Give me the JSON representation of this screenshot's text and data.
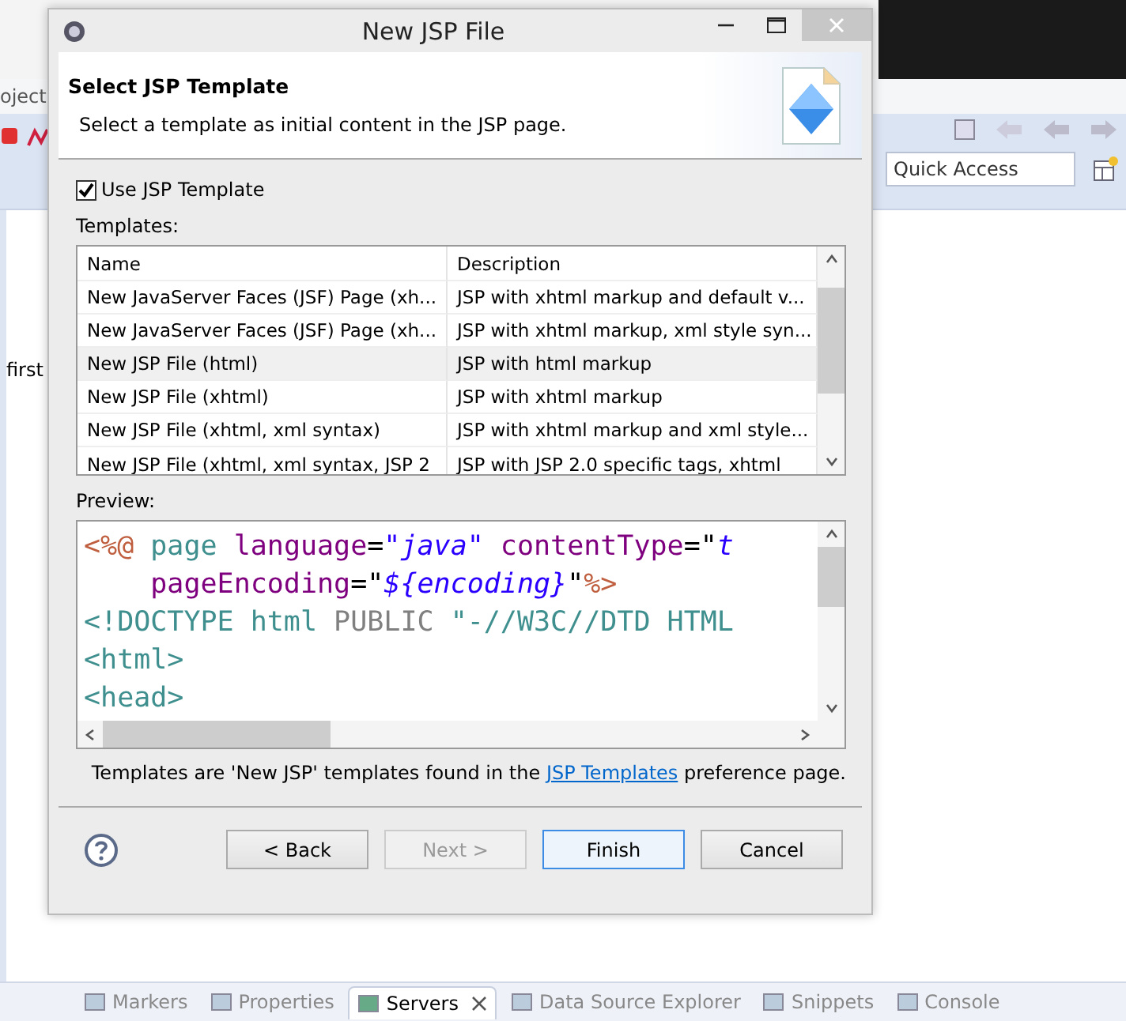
{
  "ide": {
    "menu_fragment": "oject",
    "editor_fragment": "first",
    "quick_access": {
      "placeholder": "Quick Access"
    },
    "views": [
      {
        "label": "Markers",
        "selected": false,
        "closable": false
      },
      {
        "label": "Properties",
        "selected": false,
        "closable": false
      },
      {
        "label": "Servers",
        "selected": true,
        "closable": true
      },
      {
        "label": "Data Source Explorer",
        "selected": false,
        "closable": false
      },
      {
        "label": "Snippets",
        "selected": false,
        "closable": false
      },
      {
        "label": "Console",
        "selected": false,
        "closable": false
      }
    ]
  },
  "dialog": {
    "title": "New JSP File",
    "banner": {
      "title": "Select JSP Template",
      "message": "Select a template as initial content in the JSP page."
    },
    "use_template": {
      "label": "Use JSP Template",
      "checked": true
    },
    "templates_label": "Templates:",
    "table": {
      "columns": [
        "Name",
        "Description"
      ],
      "rows": [
        {
          "name": "New JavaServer Faces (JSF) Page (xh...",
          "description": "JSP with xhtml markup and default v...",
          "selected": false
        },
        {
          "name": "New JavaServer Faces (JSF) Page (xh...",
          "description": "JSP with xhtml markup, xml style syn...",
          "selected": false
        },
        {
          "name": "New JSP File (html)",
          "description": "JSP with html markup",
          "selected": true
        },
        {
          "name": "New JSP File (xhtml)",
          "description": "JSP with xhtml markup",
          "selected": false
        },
        {
          "name": "New JSP File (xhtml, xml syntax)",
          "description": "JSP with xhtml markup and xml style...",
          "selected": false
        },
        {
          "name": "New JSP File (xhtml, xml syntax, JSP 2",
          "description": "JSP with JSP 2.0 specific tags, xhtml",
          "selected": false
        }
      ]
    },
    "preview_label": "Preview:",
    "preview_lines": [
      [
        {
          "text": "<%@",
          "kind": "delim"
        },
        {
          "text": " page",
          "kind": "tag"
        },
        {
          "text": " language",
          "kind": "attr"
        },
        {
          "text": "=",
          "kind": "plain"
        },
        {
          "text": "\"java\"",
          "kind": "value"
        },
        {
          "text": " contentType",
          "kind": "attr"
        },
        {
          "text": "=\"",
          "kind": "plain"
        },
        {
          "text": "t",
          "kind": "value"
        }
      ],
      [
        {
          "text": "    pageEncoding",
          "kind": "attr"
        },
        {
          "text": "=\"",
          "kind": "plain"
        },
        {
          "text": "${encoding}",
          "kind": "value"
        },
        {
          "text": "\"",
          "kind": "plain"
        },
        {
          "text": "%>",
          "kind": "delim"
        }
      ],
      [
        {
          "text": "<!DOCTYPE html",
          "kind": "tag"
        },
        {
          "text": " PUBLIC",
          "kind": "keyword"
        },
        {
          "text": " \"-//W3C//DTD HTML",
          "kind": "tag"
        }
      ],
      [
        {
          "text": "<html>",
          "kind": "tag"
        }
      ],
      [
        {
          "text": "<head>",
          "kind": "tag"
        }
      ]
    ],
    "footer": {
      "before": "Templates are 'New JSP' templates found in the ",
      "link": "JSP Templates",
      "after": " preference page."
    },
    "buttons": [
      {
        "label": "< Back",
        "disabled": false,
        "default": false
      },
      {
        "label": "Next >",
        "disabled": true,
        "default": false
      },
      {
        "label": "Finish",
        "disabled": false,
        "default": true
      },
      {
        "label": "Cancel",
        "disabled": false,
        "default": false
      }
    ]
  }
}
